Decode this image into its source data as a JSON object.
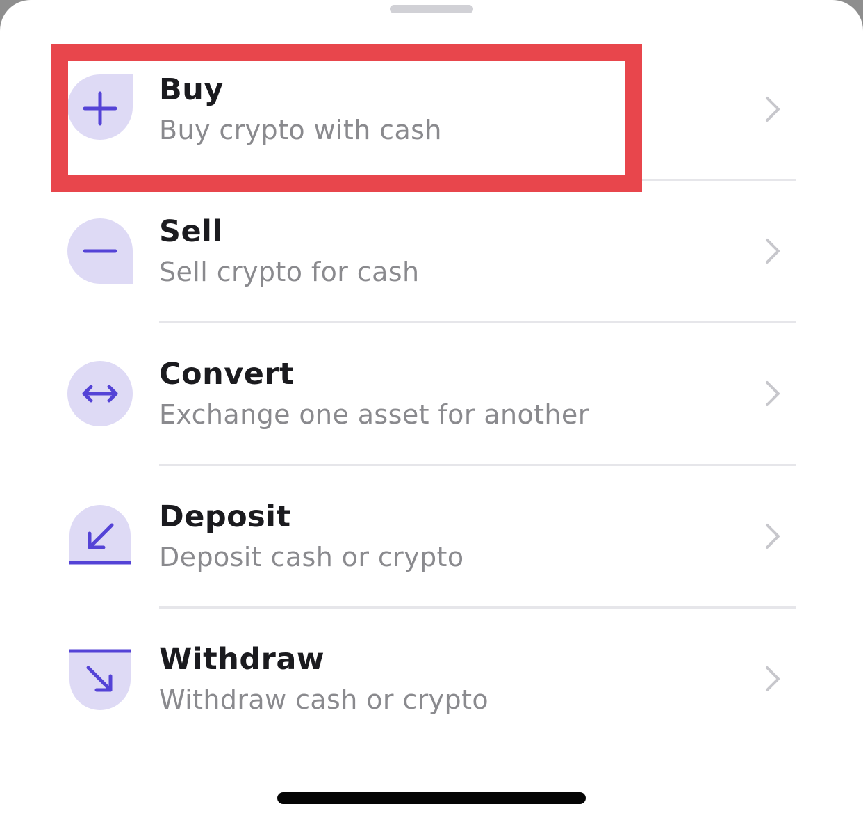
{
  "actions": [
    {
      "id": "buy",
      "title": "Buy",
      "subtitle": "Buy crypto with cash",
      "icon": "plus-icon"
    },
    {
      "id": "sell",
      "title": "Sell",
      "subtitle": "Sell crypto for cash",
      "icon": "minus-icon"
    },
    {
      "id": "convert",
      "title": "Convert",
      "subtitle": "Exchange one asset for another",
      "icon": "arrows-horizontal-icon"
    },
    {
      "id": "deposit",
      "title": "Deposit",
      "subtitle": "Deposit cash or crypto",
      "icon": "arrow-down-left-into-tray-icon"
    },
    {
      "id": "withdraw",
      "title": "Withdraw",
      "subtitle": "Withdraw cash or crypto",
      "icon": "arrow-down-right-out-of-tray-icon"
    }
  ],
  "colors": {
    "icon_bg": "#dedaf5",
    "icon_fg": "#5443d6",
    "highlight": "#e8464c",
    "chevron": "#c7c7cc"
  },
  "highlighted_action": "buy"
}
